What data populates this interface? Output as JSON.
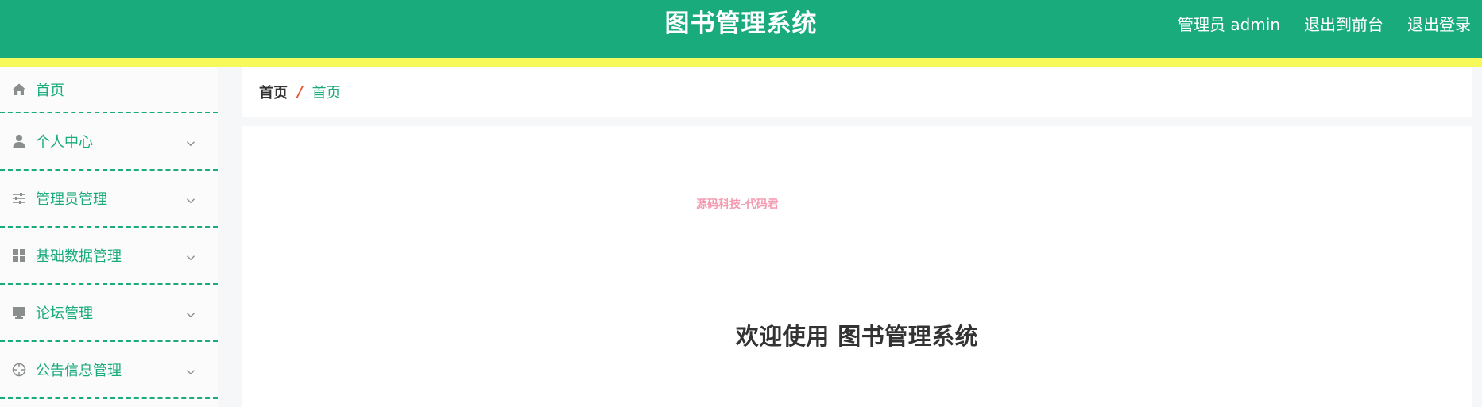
{
  "header": {
    "title": "图书管理系统",
    "user_label": "管理员 admin",
    "frontend_link": "退出到前台",
    "logout_link": "退出登录"
  },
  "sidebar": {
    "items": [
      {
        "label": "首页",
        "icon": "home-icon",
        "expandable": false
      },
      {
        "label": "个人中心",
        "icon": "user-icon",
        "expandable": true
      },
      {
        "label": "管理员管理",
        "icon": "sliders-icon",
        "expandable": true
      },
      {
        "label": "基础数据管理",
        "icon": "grid-icon",
        "expandable": true
      },
      {
        "label": "论坛管理",
        "icon": "monitor-icon",
        "expandable": true
      },
      {
        "label": "公告信息管理",
        "icon": "crosshair-icon",
        "expandable": true
      }
    ]
  },
  "breadcrumb": {
    "home": "首页",
    "separator": "/",
    "current": "首页"
  },
  "main": {
    "watermark": "源码科技-代码君",
    "welcome": "欢迎使用 图书管理系统"
  },
  "colors": {
    "primary": "#1aab7d",
    "accent_strip": "#f6f95a",
    "separator": "#e8542f",
    "watermark": "#f39ab0",
    "icon_gray": "#8a8f8d"
  }
}
